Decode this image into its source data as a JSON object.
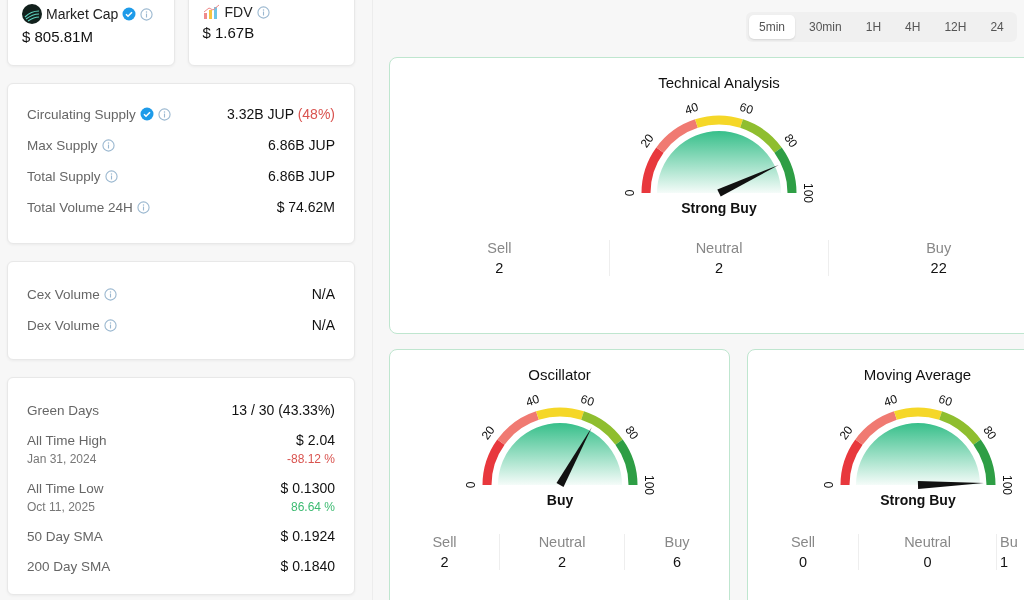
{
  "top_cards": [
    {
      "label": "Market Cap",
      "verified": true,
      "info": true,
      "value": "$ 805.81M"
    },
    {
      "label": "FDV",
      "verified": false,
      "info": true,
      "value": "$ 1.67B"
    }
  ],
  "supply_card": {
    "rows": [
      {
        "label": "Circulating Supply",
        "verified": true,
        "info": true,
        "value": "3.32B JUP",
        "note": "(48%)"
      },
      {
        "label": "Max Supply",
        "verified": false,
        "info": true,
        "value": "6.86B JUP"
      },
      {
        "label": "Total Supply",
        "verified": false,
        "info": true,
        "value": "6.86B JUP"
      },
      {
        "label": "Total Volume 24H",
        "verified": false,
        "info": true,
        "value": "$ 74.62M"
      }
    ]
  },
  "volume_card": {
    "rows": [
      {
        "label": "Cex Volume",
        "verified": false,
        "info": true,
        "value": "N/A"
      },
      {
        "label": "Dex Volume",
        "verified": false,
        "info": true,
        "value": "N/A"
      }
    ]
  },
  "stats_card": {
    "rows": [
      {
        "label": "Green Days",
        "value": "13 / 30 (43.33%)"
      },
      {
        "label": "All Time High",
        "value": "$ 2.04",
        "date": "Jan 31, 2024",
        "change": "-88.12 %",
        "color": "#d9534f"
      },
      {
        "label": "All Time Low",
        "value": "$ 0.1300",
        "date": "Oct 11, 2025",
        "change": "86.64 %",
        "color": "#3dbb72"
      },
      {
        "label": "50 Day SMA",
        "value": "$ 0.1924"
      },
      {
        "label": "200 Day SMA",
        "value": "$ 0.1840"
      }
    ]
  },
  "timeframe_tabs": [
    {
      "label": "5min",
      "selected": true
    },
    {
      "label": "30min",
      "selected": false
    },
    {
      "label": "1H",
      "selected": false
    },
    {
      "label": "4H",
      "selected": false
    },
    {
      "label": "12H",
      "selected": false
    },
    {
      "label": "24",
      "selected": false
    }
  ],
  "gauges": [
    {
      "title": "Technical Analysis",
      "reading": "Strong Buy",
      "ticks": [
        "0",
        "20",
        "40",
        "60",
        "80",
        "100"
      ],
      "counts": [
        {
          "label": "Sell",
          "value": "2"
        },
        {
          "label": "Neutral",
          "value": "2"
        },
        {
          "label": "Buy",
          "value": "22"
        }
      ]
    },
    {
      "title": "Oscillator",
      "reading": "Buy",
      "ticks": [
        "0",
        "20",
        "40",
        "60",
        "80",
        "100"
      ],
      "counts": [
        {
          "label": "Sell",
          "value": "2"
        },
        {
          "label": "Neutral",
          "value": "2"
        },
        {
          "label": "Buy",
          "value": "6"
        }
      ]
    },
    {
      "title": "Moving Average",
      "reading": "Strong Buy",
      "ticks": [
        "0",
        "20",
        "40",
        "60",
        "80",
        "100"
      ],
      "counts": [
        {
          "label": "Sell",
          "value": "0"
        },
        {
          "label": "Neutral",
          "value": "0"
        },
        {
          "label": "Bu",
          "value": "1"
        }
      ]
    }
  ]
}
